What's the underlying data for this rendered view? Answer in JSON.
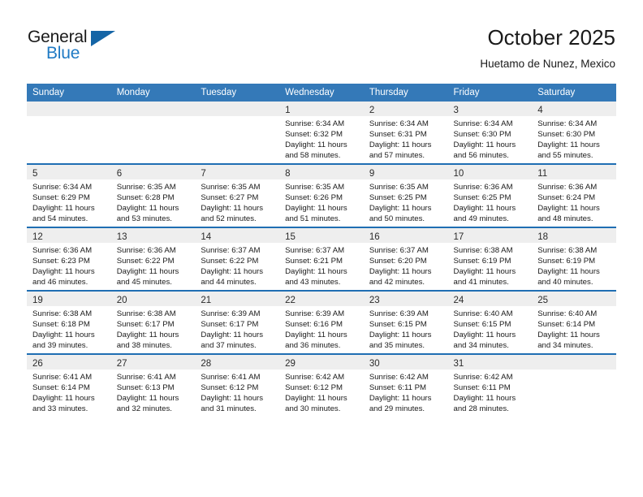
{
  "brand": {
    "name_part1": "General",
    "name_part2": "Blue",
    "logo_icon": "triangle-flag-icon",
    "accent_color": "#1f7ac4"
  },
  "header": {
    "month_title": "October 2025",
    "location": "Huetamo de Nunez, Mexico"
  },
  "calendar": {
    "header_bg": "#3479b8",
    "row_border": "#1f6eb3",
    "daynum_bg": "#eeeeee",
    "weekday_headers": [
      "Sunday",
      "Monday",
      "Tuesday",
      "Wednesday",
      "Thursday",
      "Friday",
      "Saturday"
    ],
    "labels": {
      "sunrise": "Sunrise:",
      "sunset": "Sunset:",
      "daylight": "Daylight:"
    },
    "weeks": [
      [
        {
          "day": "",
          "sunrise": "",
          "sunset": "",
          "daylight_l1": "",
          "daylight_l2": ""
        },
        {
          "day": "",
          "sunrise": "",
          "sunset": "",
          "daylight_l1": "",
          "daylight_l2": ""
        },
        {
          "day": "",
          "sunrise": "",
          "sunset": "",
          "daylight_l1": "",
          "daylight_l2": ""
        },
        {
          "day": "1",
          "sunrise": "Sunrise: 6:34 AM",
          "sunset": "Sunset: 6:32 PM",
          "daylight_l1": "Daylight: 11 hours",
          "daylight_l2": "and 58 minutes."
        },
        {
          "day": "2",
          "sunrise": "Sunrise: 6:34 AM",
          "sunset": "Sunset: 6:31 PM",
          "daylight_l1": "Daylight: 11 hours",
          "daylight_l2": "and 57 minutes."
        },
        {
          "day": "3",
          "sunrise": "Sunrise: 6:34 AM",
          "sunset": "Sunset: 6:30 PM",
          "daylight_l1": "Daylight: 11 hours",
          "daylight_l2": "and 56 minutes."
        },
        {
          "day": "4",
          "sunrise": "Sunrise: 6:34 AM",
          "sunset": "Sunset: 6:30 PM",
          "daylight_l1": "Daylight: 11 hours",
          "daylight_l2": "and 55 minutes."
        }
      ],
      [
        {
          "day": "5",
          "sunrise": "Sunrise: 6:34 AM",
          "sunset": "Sunset: 6:29 PM",
          "daylight_l1": "Daylight: 11 hours",
          "daylight_l2": "and 54 minutes."
        },
        {
          "day": "6",
          "sunrise": "Sunrise: 6:35 AM",
          "sunset": "Sunset: 6:28 PM",
          "daylight_l1": "Daylight: 11 hours",
          "daylight_l2": "and 53 minutes."
        },
        {
          "day": "7",
          "sunrise": "Sunrise: 6:35 AM",
          "sunset": "Sunset: 6:27 PM",
          "daylight_l1": "Daylight: 11 hours",
          "daylight_l2": "and 52 minutes."
        },
        {
          "day": "8",
          "sunrise": "Sunrise: 6:35 AM",
          "sunset": "Sunset: 6:26 PM",
          "daylight_l1": "Daylight: 11 hours",
          "daylight_l2": "and 51 minutes."
        },
        {
          "day": "9",
          "sunrise": "Sunrise: 6:35 AM",
          "sunset": "Sunset: 6:25 PM",
          "daylight_l1": "Daylight: 11 hours",
          "daylight_l2": "and 50 minutes."
        },
        {
          "day": "10",
          "sunrise": "Sunrise: 6:36 AM",
          "sunset": "Sunset: 6:25 PM",
          "daylight_l1": "Daylight: 11 hours",
          "daylight_l2": "and 49 minutes."
        },
        {
          "day": "11",
          "sunrise": "Sunrise: 6:36 AM",
          "sunset": "Sunset: 6:24 PM",
          "daylight_l1": "Daylight: 11 hours",
          "daylight_l2": "and 48 minutes."
        }
      ],
      [
        {
          "day": "12",
          "sunrise": "Sunrise: 6:36 AM",
          "sunset": "Sunset: 6:23 PM",
          "daylight_l1": "Daylight: 11 hours",
          "daylight_l2": "and 46 minutes."
        },
        {
          "day": "13",
          "sunrise": "Sunrise: 6:36 AM",
          "sunset": "Sunset: 6:22 PM",
          "daylight_l1": "Daylight: 11 hours",
          "daylight_l2": "and 45 minutes."
        },
        {
          "day": "14",
          "sunrise": "Sunrise: 6:37 AM",
          "sunset": "Sunset: 6:22 PM",
          "daylight_l1": "Daylight: 11 hours",
          "daylight_l2": "and 44 minutes."
        },
        {
          "day": "15",
          "sunrise": "Sunrise: 6:37 AM",
          "sunset": "Sunset: 6:21 PM",
          "daylight_l1": "Daylight: 11 hours",
          "daylight_l2": "and 43 minutes."
        },
        {
          "day": "16",
          "sunrise": "Sunrise: 6:37 AM",
          "sunset": "Sunset: 6:20 PM",
          "daylight_l1": "Daylight: 11 hours",
          "daylight_l2": "and 42 minutes."
        },
        {
          "day": "17",
          "sunrise": "Sunrise: 6:38 AM",
          "sunset": "Sunset: 6:19 PM",
          "daylight_l1": "Daylight: 11 hours",
          "daylight_l2": "and 41 minutes."
        },
        {
          "day": "18",
          "sunrise": "Sunrise: 6:38 AM",
          "sunset": "Sunset: 6:19 PM",
          "daylight_l1": "Daylight: 11 hours",
          "daylight_l2": "and 40 minutes."
        }
      ],
      [
        {
          "day": "19",
          "sunrise": "Sunrise: 6:38 AM",
          "sunset": "Sunset: 6:18 PM",
          "daylight_l1": "Daylight: 11 hours",
          "daylight_l2": "and 39 minutes."
        },
        {
          "day": "20",
          "sunrise": "Sunrise: 6:38 AM",
          "sunset": "Sunset: 6:17 PM",
          "daylight_l1": "Daylight: 11 hours",
          "daylight_l2": "and 38 minutes."
        },
        {
          "day": "21",
          "sunrise": "Sunrise: 6:39 AM",
          "sunset": "Sunset: 6:17 PM",
          "daylight_l1": "Daylight: 11 hours",
          "daylight_l2": "and 37 minutes."
        },
        {
          "day": "22",
          "sunrise": "Sunrise: 6:39 AM",
          "sunset": "Sunset: 6:16 PM",
          "daylight_l1": "Daylight: 11 hours",
          "daylight_l2": "and 36 minutes."
        },
        {
          "day": "23",
          "sunrise": "Sunrise: 6:39 AM",
          "sunset": "Sunset: 6:15 PM",
          "daylight_l1": "Daylight: 11 hours",
          "daylight_l2": "and 35 minutes."
        },
        {
          "day": "24",
          "sunrise": "Sunrise: 6:40 AM",
          "sunset": "Sunset: 6:15 PM",
          "daylight_l1": "Daylight: 11 hours",
          "daylight_l2": "and 34 minutes."
        },
        {
          "day": "25",
          "sunrise": "Sunrise: 6:40 AM",
          "sunset": "Sunset: 6:14 PM",
          "daylight_l1": "Daylight: 11 hours",
          "daylight_l2": "and 34 minutes."
        }
      ],
      [
        {
          "day": "26",
          "sunrise": "Sunrise: 6:41 AM",
          "sunset": "Sunset: 6:14 PM",
          "daylight_l1": "Daylight: 11 hours",
          "daylight_l2": "and 33 minutes."
        },
        {
          "day": "27",
          "sunrise": "Sunrise: 6:41 AM",
          "sunset": "Sunset: 6:13 PM",
          "daylight_l1": "Daylight: 11 hours",
          "daylight_l2": "and 32 minutes."
        },
        {
          "day": "28",
          "sunrise": "Sunrise: 6:41 AM",
          "sunset": "Sunset: 6:12 PM",
          "daylight_l1": "Daylight: 11 hours",
          "daylight_l2": "and 31 minutes."
        },
        {
          "day": "29",
          "sunrise": "Sunrise: 6:42 AM",
          "sunset": "Sunset: 6:12 PM",
          "daylight_l1": "Daylight: 11 hours",
          "daylight_l2": "and 30 minutes."
        },
        {
          "day": "30",
          "sunrise": "Sunrise: 6:42 AM",
          "sunset": "Sunset: 6:11 PM",
          "daylight_l1": "Daylight: 11 hours",
          "daylight_l2": "and 29 minutes."
        },
        {
          "day": "31",
          "sunrise": "Sunrise: 6:42 AM",
          "sunset": "Sunset: 6:11 PM",
          "daylight_l1": "Daylight: 11 hours",
          "daylight_l2": "and 28 minutes."
        },
        {
          "day": "",
          "sunrise": "",
          "sunset": "",
          "daylight_l1": "",
          "daylight_l2": ""
        }
      ]
    ]
  }
}
